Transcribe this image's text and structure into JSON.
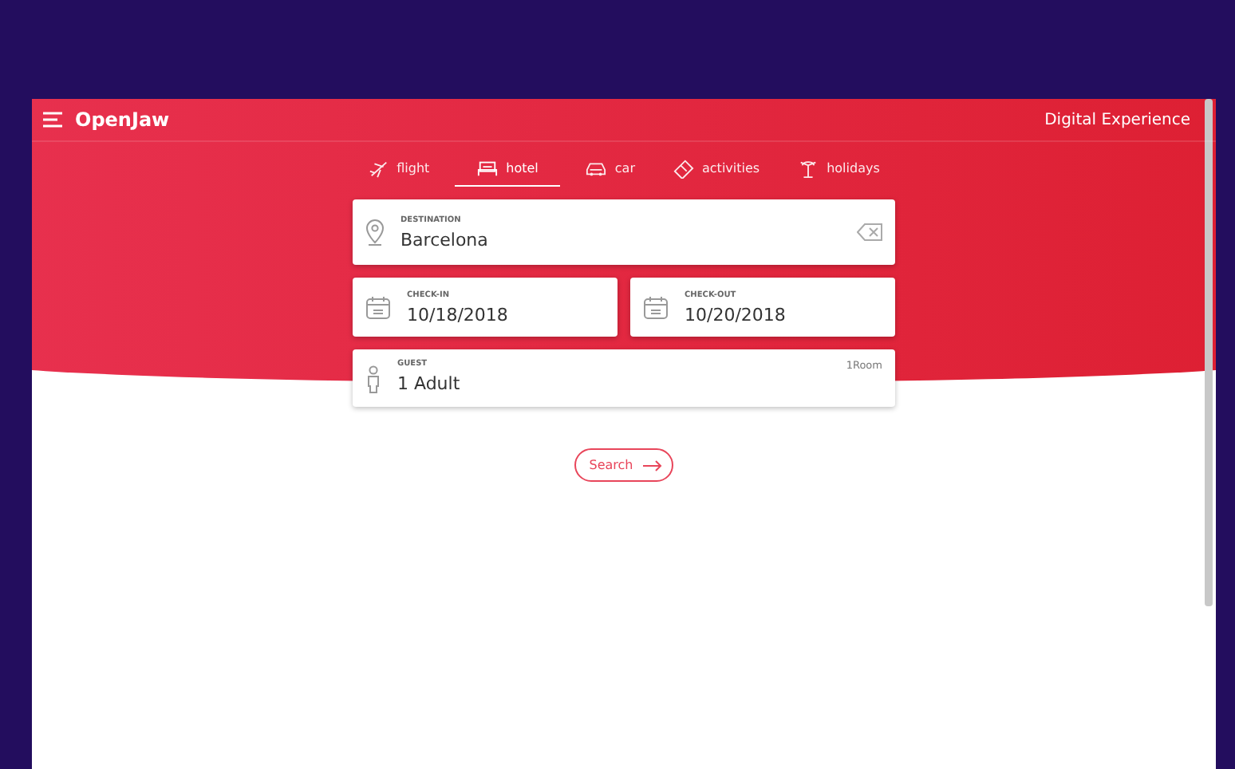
{
  "app_bar": {
    "logo": "OpenJaw",
    "title": "Digital Experience"
  },
  "tabs": [
    {
      "label": "flight",
      "kind": "flight",
      "selected": false
    },
    {
      "label": "hotel",
      "kind": "hotel",
      "selected": true
    },
    {
      "label": "car",
      "kind": "car",
      "selected": false
    },
    {
      "label": "activities",
      "kind": "activities",
      "selected": false
    },
    {
      "label": "holidays",
      "kind": "holidays",
      "selected": false
    }
  ],
  "destination": {
    "label": "DESTINATION",
    "value": "Barcelona"
  },
  "check_in": {
    "label": "CHECK-IN",
    "value": "10/18/2018"
  },
  "check_out": {
    "label": "CHECK-OUT",
    "value": "10/20/2018"
  },
  "guest": {
    "label": "GUEST",
    "value": "1 Adult",
    "rooms": "1Room"
  },
  "search_button": "Search"
}
